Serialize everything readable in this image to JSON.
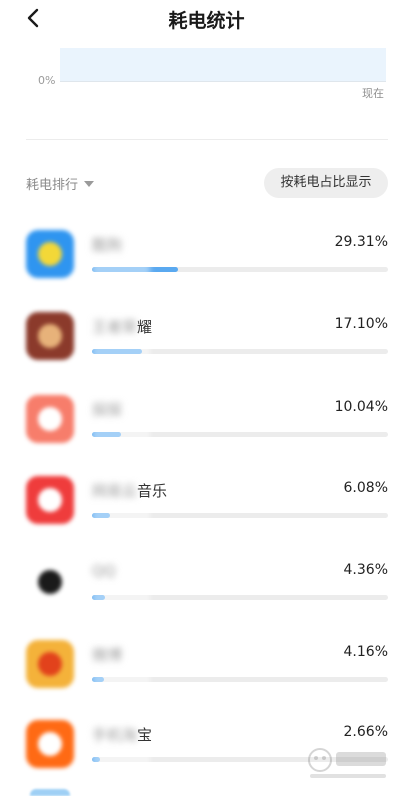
{
  "header": {
    "title": "耗电统计",
    "back_icon": "chevron-left-icon"
  },
  "chart": {
    "y_zero_label": "0%",
    "x_end_label": "现在",
    "fill_color": "#eaf4fd"
  },
  "ranking": {
    "sort_label": "耗电排行",
    "toggle_label": "按耗电占比显示"
  },
  "apps": [
    {
      "name_hidden": "酷狗",
      "name_visible": "",
      "percent": "29.31%",
      "fraction": 0.2931,
      "icon": "app-icon-yellow",
      "icon_color": "#2f95f0",
      "icon_inner": "#f3d838"
    },
    {
      "name_hidden": "王者荣",
      "name_visible": "耀",
      "percent": "17.10%",
      "fraction": 0.171,
      "icon": "app-icon-game",
      "icon_color": "#8b3a2b",
      "icon_inner": "#e7b27a"
    },
    {
      "name_hidden": "探探",
      "name_visible": "",
      "percent": "10.04%",
      "fraction": 0.1004,
      "icon": "app-icon-coral",
      "icon_color": "#f77d6b",
      "icon_inner": "#ffffff"
    },
    {
      "name_hidden": "网易云",
      "name_visible": "音乐",
      "percent": "6.08%",
      "fraction": 0.0608,
      "icon": "app-icon-music",
      "icon_color": "#ef3c3c",
      "icon_inner": "#ffffff"
    },
    {
      "name_hidden": "QQ",
      "name_visible": "",
      "percent": "4.36%",
      "fraction": 0.0436,
      "icon": "app-icon-penguin",
      "icon_color": "#ffffff",
      "icon_inner": "#1a1a1a"
    },
    {
      "name_hidden": "微博",
      "name_visible": "",
      "percent": "4.16%",
      "fraction": 0.0416,
      "icon": "app-icon-weibo",
      "icon_color": "#f4b23a",
      "icon_inner": "#e2421c"
    },
    {
      "name_hidden": "手机淘",
      "name_visible": "宝",
      "percent": "2.66%",
      "fraction": 0.0266,
      "icon": "app-icon-taobao",
      "icon_color": "#ff6a14",
      "icon_inner": "#ffffff"
    }
  ],
  "colors": {
    "bar_fill": "#5aa9f0",
    "bar_track": "#ececec"
  }
}
